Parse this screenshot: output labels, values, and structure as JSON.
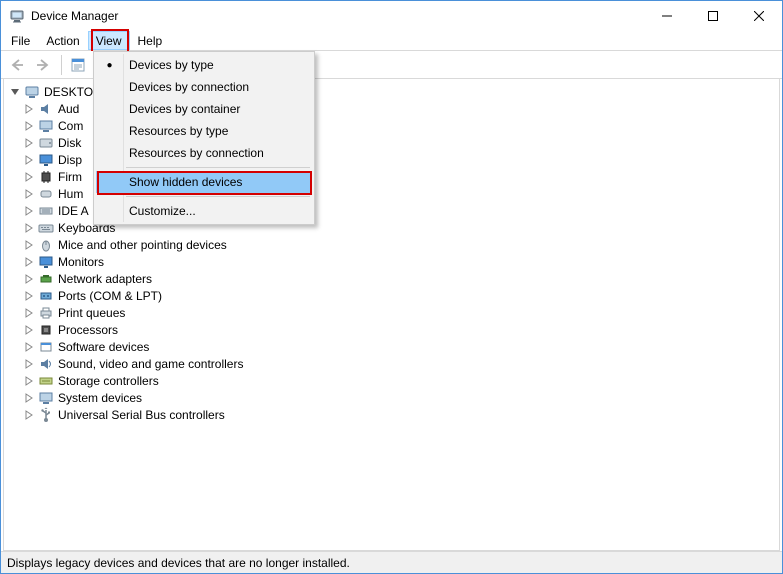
{
  "title": "Device Manager",
  "menubar": [
    "File",
    "Action",
    "View",
    "Help"
  ],
  "menubar_open_index": 2,
  "toolbar": {
    "back": "back-arrow-icon",
    "forward": "forward-arrow-icon",
    "properties": "properties-icon",
    "help": "help-icon"
  },
  "tree": {
    "root": "DESKTO",
    "items": [
      "Aud",
      "Com",
      "Disk",
      "Disp",
      "Firm",
      "Hum",
      "IDE A",
      "Keyboards",
      "Mice and other pointing devices",
      "Monitors",
      "Network adapters",
      "Ports (COM & LPT)",
      "Print queues",
      "Processors",
      "Software devices",
      "Sound, video and game controllers",
      "Storage controllers",
      "System devices",
      "Universal Serial Bus controllers"
    ]
  },
  "dropdown": {
    "items": [
      "Devices by type",
      "Devices by connection",
      "Devices by container",
      "Resources by type",
      "Resources by connection"
    ],
    "checked_index": 0,
    "highlighted": "Show hidden devices",
    "last": "Customize..."
  },
  "statusbar": "Displays legacy devices and devices that are no longer installed."
}
